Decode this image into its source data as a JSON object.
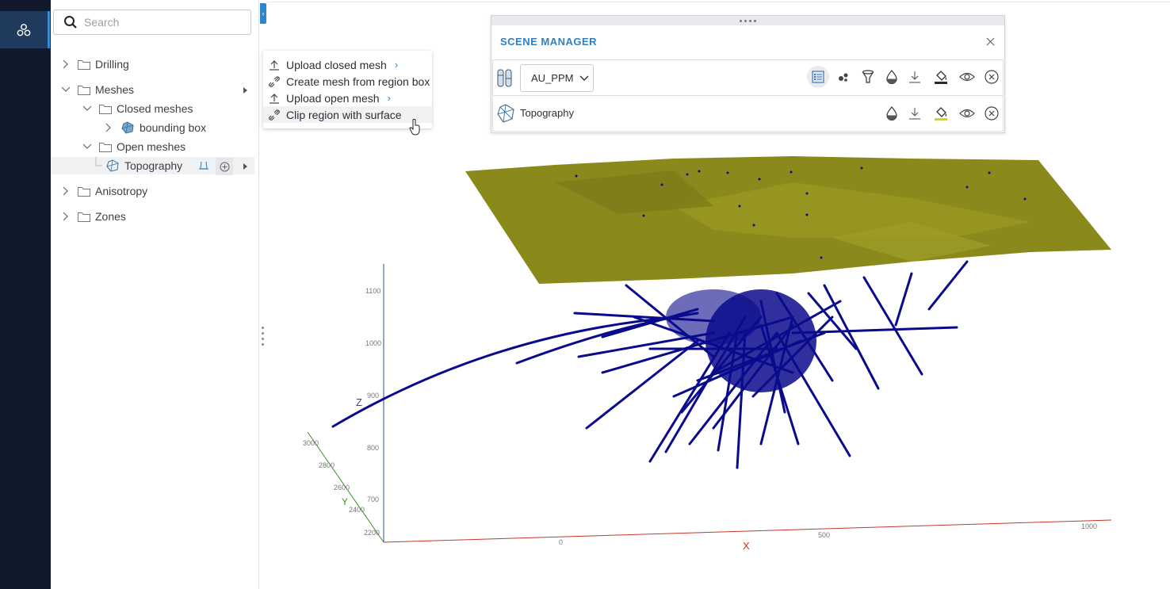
{
  "rail": {
    "app_icon": "cubes-icon"
  },
  "search": {
    "placeholder": "Search",
    "value": ""
  },
  "tree": {
    "drilling": "Drilling",
    "meshes": "Meshes",
    "closed_meshes": "Closed meshes",
    "bounding_box": "bounding box",
    "open_meshes": "Open meshes",
    "topography": "Topography",
    "anisotropy": "Anisotropy",
    "zones": "Zones"
  },
  "context_menu": {
    "items": [
      "Upload closed mesh",
      "Create mesh from region box",
      "Upload open mesh",
      "Clip region with surface"
    ]
  },
  "scene_manager": {
    "title": "SCENE MANAGER",
    "attribute": "AU_PPM",
    "layer_name": "Topography"
  },
  "viewport": {
    "axis_x_label": "X",
    "axis_y_label": "Y",
    "axis_z_label": "Z",
    "z_ticks": [
      "1100",
      "1000",
      "900",
      "800",
      "700"
    ],
    "y_ticks": [
      "3000",
      "2800",
      "2600",
      "2400",
      "2200"
    ],
    "x_ticks": [
      "0",
      "500",
      "1000"
    ],
    "colors": {
      "surface": "#8a8a1c",
      "drillholes": "#0a0a8c",
      "x_axis": "#c0392b",
      "y_axis": "#3c8c28",
      "z_axis": "#2c4f9c"
    }
  }
}
